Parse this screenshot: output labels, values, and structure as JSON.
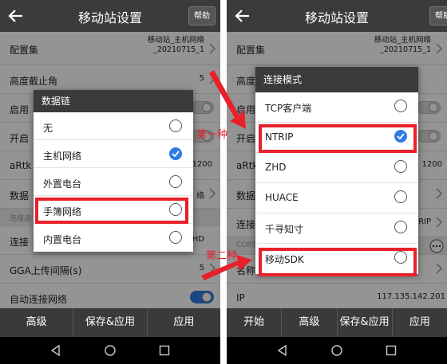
{
  "left": {
    "title": "移动站设置",
    "help_label": "帮助",
    "rows": [
      {
        "label": "配置集",
        "value_line1": "移动站_主机网络",
        "value_line2": "_20210715_1"
      },
      {
        "label": "高度截止角",
        "value": "5"
      },
      {
        "label": "启用"
      },
      {
        "label": "开启"
      },
      {
        "label": "aRtk",
        "value": "1200"
      },
      {
        "label": "数据",
        "value": "络"
      },
      {
        "label": "连接选"
      },
      {
        "label": "连接",
        "value": "HD"
      },
      {
        "label": "GGA上传间隔(s)",
        "value": "5"
      },
      {
        "label": "自动连接网络"
      }
    ],
    "dialog": {
      "title": "数据链",
      "options": [
        {
          "label": "无",
          "selected": false
        },
        {
          "label": "主机网络",
          "selected": true
        },
        {
          "label": "外置电台",
          "selected": false
        },
        {
          "label": "手簿网络",
          "selected": false
        },
        {
          "label": "内置电台",
          "selected": false
        }
      ]
    },
    "bottom_buttons": [
      "高级",
      "保存&应用",
      "应用"
    ]
  },
  "right": {
    "title": "移动站设置",
    "help_label": "帮助",
    "rows": [
      {
        "label": "配置集",
        "value_line1": "移动站_主机网络",
        "value_line2": "_20210715_1"
      },
      {
        "label": "高度"
      },
      {
        "label": "启用"
      },
      {
        "label": "开启"
      },
      {
        "label": "aRtk",
        "value": "1200"
      },
      {
        "label": "数据"
      },
      {
        "label": "连接",
        "value": "RIP"
      },
      {
        "label": "CORS"
      },
      {
        "label": "名称"
      },
      {
        "label": "IP",
        "value": "117.135.142.201"
      }
    ],
    "dialog": {
      "title": "连接模式",
      "options": [
        {
          "label": "TCP客户端",
          "selected": false
        },
        {
          "label": "NTRIP",
          "selected": true
        },
        {
          "label": "ZHD",
          "selected": false
        },
        {
          "label": "HUACE",
          "selected": false
        },
        {
          "label": "千寻知寸",
          "selected": false
        },
        {
          "label": "移动SDK",
          "selected": false
        }
      ]
    },
    "bottom_buttons": [
      "开始",
      "高级",
      "保存&应用",
      "应用"
    ]
  },
  "annotations": {
    "first": "第一种",
    "second": "第二种"
  },
  "colors": {
    "highlight": "#e8202a",
    "accent": "#2f7be0",
    "titlebar": "#3b3b3b"
  }
}
